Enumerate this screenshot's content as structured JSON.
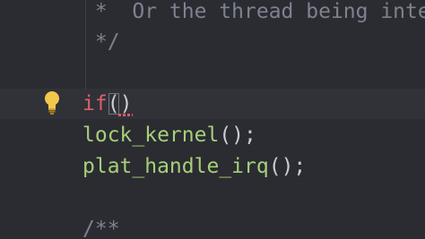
{
  "editor": {
    "lines": [
      {
        "prefix": " *  ",
        "text": "Or the thread being inte"
      },
      {
        "text": " */"
      },
      {
        "text": ""
      },
      {
        "keyword": "if",
        "open": "(",
        "close": ")"
      },
      {
        "call": "lock_kernel",
        "punct": "();"
      },
      {
        "call": "plat_handle_irq",
        "punct": "();"
      },
      {
        "text": ""
      },
      {
        "text": "/**"
      }
    ],
    "gutter_icon": "lightbulb-icon",
    "colors": {
      "background": "#2a2c31",
      "current_line": "#303238",
      "comment": "#7d8290",
      "keyword": "#d9606a",
      "function": "#a7cf7a",
      "punctuation": "#c9ccd3",
      "error_squiggle": "#e0566a",
      "bulb": "#f2c84b"
    }
  }
}
